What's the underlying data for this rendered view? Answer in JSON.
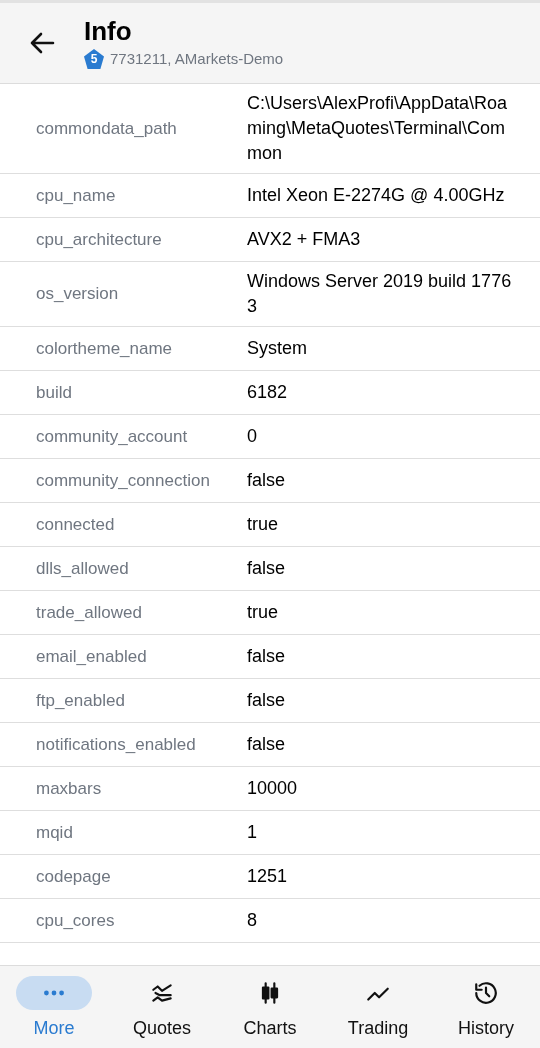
{
  "header": {
    "title": "Info",
    "badge": "5",
    "account": "7731211, AMarkets-Demo"
  },
  "rows": [
    {
      "key": "commondata_path",
      "value": "C:\\Users\\AlexProfi\\AppData\\Roaming\\MetaQuotes\\Terminal\\Common"
    },
    {
      "key": "cpu_name",
      "value": "Intel Xeon E-2274G  @ 4.00GHz"
    },
    {
      "key": "cpu_architecture",
      "value": "AVX2 + FMA3"
    },
    {
      "key": "os_version",
      "value": "Windows Server 2019 build 17763"
    },
    {
      "key": "colortheme_name",
      "value": "System"
    },
    {
      "key": "build",
      "value": "6182"
    },
    {
      "key": "community_account",
      "value": "0"
    },
    {
      "key": "community_connection",
      "value": "false"
    },
    {
      "key": "connected",
      "value": "true"
    },
    {
      "key": "dlls_allowed",
      "value": "false"
    },
    {
      "key": "trade_allowed",
      "value": "true"
    },
    {
      "key": "email_enabled",
      "value": "false"
    },
    {
      "key": "ftp_enabled",
      "value": "false"
    },
    {
      "key": "notifications_enabled",
      "value": "false"
    },
    {
      "key": "maxbars",
      "value": "10000"
    },
    {
      "key": "mqid",
      "value": "1"
    },
    {
      "key": "codepage",
      "value": "1251"
    },
    {
      "key": "cpu_cores",
      "value": "8"
    }
  ],
  "nav": [
    {
      "kind": "more",
      "label": "More",
      "selected": true
    },
    {
      "kind": "quotes",
      "label": "Quotes",
      "selected": false
    },
    {
      "kind": "charts",
      "label": "Charts",
      "selected": false
    },
    {
      "kind": "trading",
      "label": "Trading",
      "selected": false
    },
    {
      "kind": "history",
      "label": "History",
      "selected": false
    }
  ]
}
